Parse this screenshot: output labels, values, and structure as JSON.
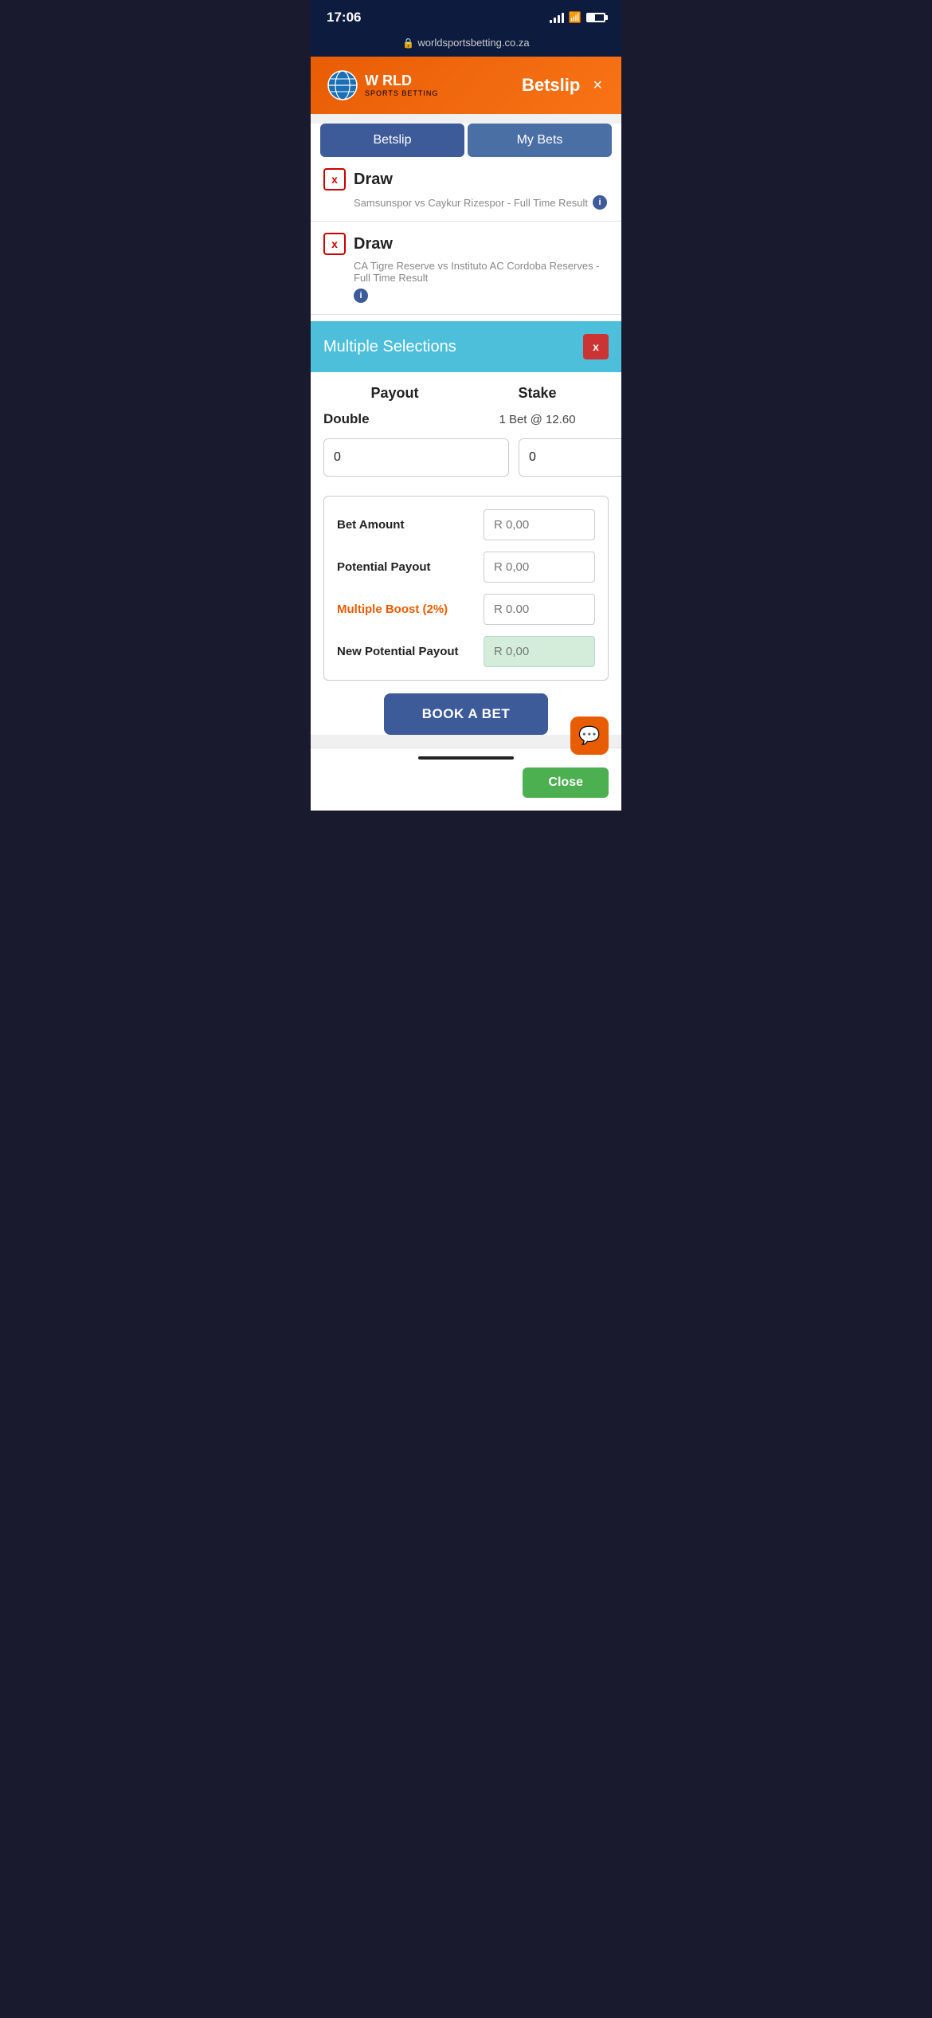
{
  "statusBar": {
    "time": "17:06",
    "url": "worldsportsbetting.co.za"
  },
  "header": {
    "logoText": "W RLD",
    "logoSub": "SPORTS BETTING",
    "betslipLabel": "Betslip",
    "closeLabel": "×"
  },
  "tabs": {
    "betslipLabel": "Betslip",
    "myBetsLabel": "My Bets"
  },
  "betItems": [
    {
      "selection": "Draw",
      "match": "Samsunspor vs Caykur Rizespor - Full Time Result",
      "removeLabel": "x"
    },
    {
      "selection": "Draw",
      "match": "CA Tigre Reserve vs Instituto AC Cordoba Reserves - Full Time Result",
      "removeLabel": "x"
    }
  ],
  "multipleSelections": {
    "label": "Multiple Selections",
    "closeLabel": "x"
  },
  "payoutStake": {
    "payoutHeader": "Payout",
    "stakeHeader": "Stake",
    "doubleLabel": "Double",
    "doubleValue": "1 Bet @ 12.60",
    "payoutValue": "0",
    "stakeValue": "0"
  },
  "summary": {
    "betAmountLabel": "Bet Amount",
    "betAmountValue": "R 0,00",
    "potentialPayoutLabel": "Potential Payout",
    "potentialPayoutValue": "R 0,00",
    "multipleBoostLabel": "Multiple Boost (2%)",
    "multipleBoostValue": "R 0.00",
    "newPotentialPayoutLabel": "New Potential Payout",
    "newPotentialPayoutValue": "R 0,00"
  },
  "bookBetLabel": "BOOK A BET",
  "closeBottomLabel": "Close"
}
